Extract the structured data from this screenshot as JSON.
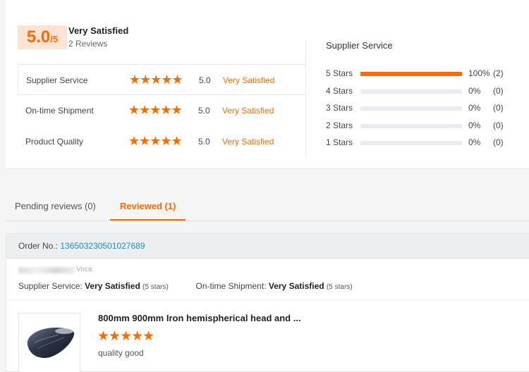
{
  "summary": {
    "score": "5.0",
    "score_max": "/5",
    "overall_label": "Very Satisfied",
    "reviews_count": "2 Reviews",
    "metrics": [
      {
        "label": "Supplier Service",
        "stars": "★★★★★",
        "score": "5.0",
        "text": "Very Satisfied"
      },
      {
        "label": "On-time Shipment",
        "stars": "★★★★★",
        "score": "5.0",
        "text": "Very Satisfied"
      },
      {
        "label": "Product Quality",
        "stars": "★★★★★",
        "score": "5.0",
        "text": "Very Satisfied"
      }
    ]
  },
  "distribution": {
    "title": "Supplier Service",
    "accent_color": "#ff6a00",
    "rows": [
      {
        "label": "5 Stars",
        "fraction": 1.0,
        "pct": "100%",
        "count": "(2)"
      },
      {
        "label": "4 Stars",
        "fraction": 0,
        "pct": "0%",
        "count": "(0)"
      },
      {
        "label": "3 Stars",
        "fraction": 0,
        "pct": "0%",
        "count": "(0)"
      },
      {
        "label": "2 Stars",
        "fraction": 0,
        "pct": "0%",
        "count": "(0)"
      },
      {
        "label": "1 Stars",
        "fraction": 0,
        "pct": "0%",
        "count": "(0)"
      }
    ]
  },
  "tabs": {
    "pending": "Pending reviews (0)",
    "reviewed": "Reviewed (1)"
  },
  "order": {
    "number_label": "Order No.:",
    "number_value": "136503230501027689",
    "buyer_country": "Vrica",
    "supplier_service_label": "Supplier Service:",
    "supplier_service_value": "Very Satisfied",
    "supplier_service_stars": "(5 stars)",
    "ontime_label": "On-time Shipment:",
    "ontime_value": "Very Satisfied",
    "ontime_stars": "(5 stars)"
  },
  "product": {
    "title": "800mm 900mm Iron hemispherical head and ...",
    "stars": "★★★★★",
    "comment": "quality good"
  }
}
